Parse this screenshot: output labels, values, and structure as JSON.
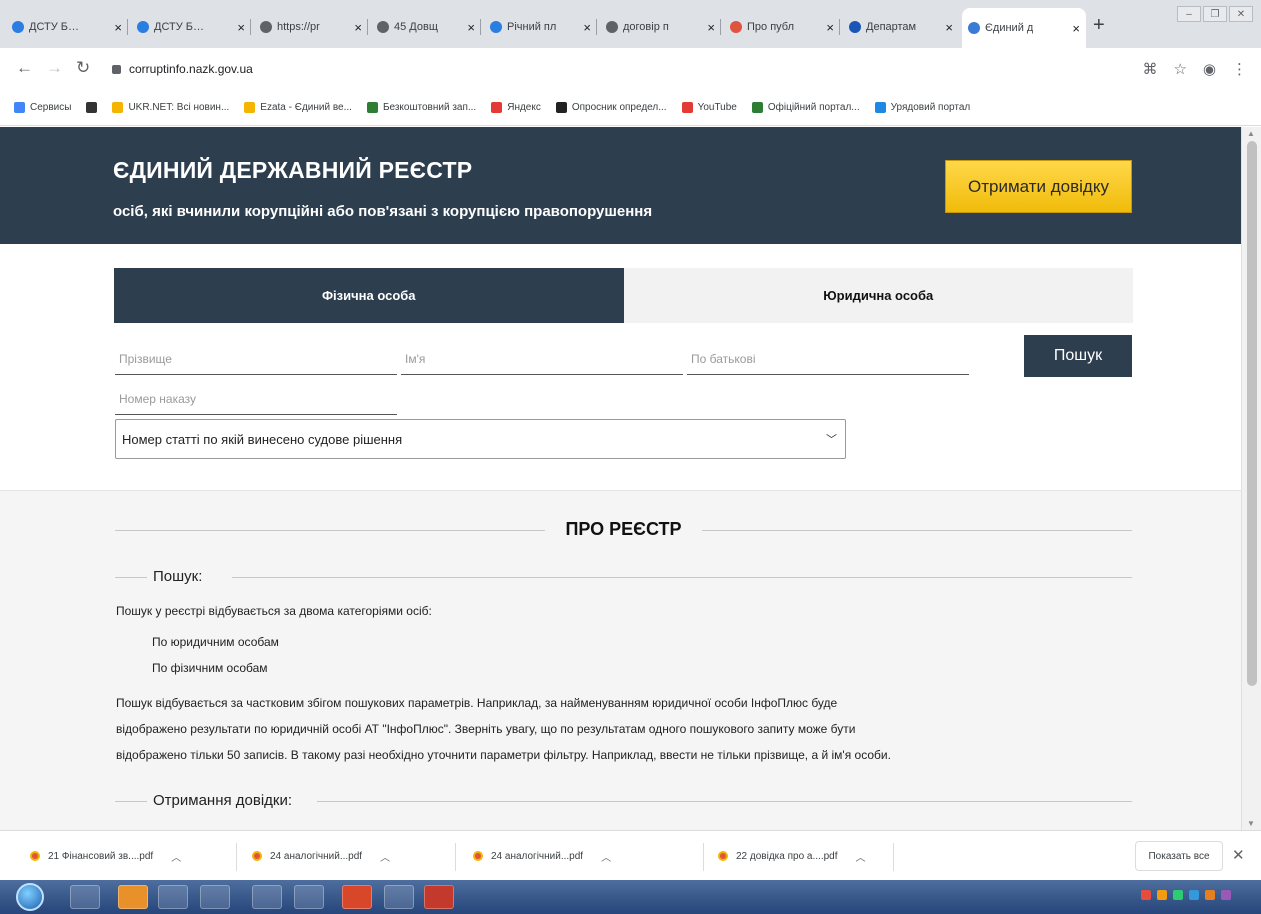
{
  "browser": {
    "tabs": [
      {
        "label": "ДСТУ Б.Д.",
        "color": "#2a7de1"
      },
      {
        "label": "ДСТУ Б.Д.",
        "color": "#2a7de1"
      },
      {
        "label": "https://pr",
        "color": "#5f6368"
      },
      {
        "label": "45 Довщ",
        "color": "#5f6368"
      },
      {
        "label": "Річний пл",
        "color": "#2a7de1"
      },
      {
        "label": "договір п",
        "color": "#5f6368"
      },
      {
        "label": "Про публ",
        "color": "#e0533f"
      },
      {
        "label": "Департам",
        "color": "#1a56b8"
      },
      {
        "label": "Єдиний д",
        "color": "#3a7bd5",
        "active": true
      }
    ],
    "url": "corruptinfo.nazk.gov.ua",
    "bookmarks": [
      {
        "label": "Сервисы",
        "color": "#4285f4"
      },
      {
        "label": "",
        "color": "#333333"
      },
      {
        "label": "UKR.NET: Всі новин...",
        "color": "#f4b400"
      },
      {
        "label": "Ezata - Єдиний ве...",
        "color": "#f4b400"
      },
      {
        "label": "Безкоштовний зап...",
        "color": "#2e7d32"
      },
      {
        "label": "Яндекс",
        "color": "#e53935"
      },
      {
        "label": "Опросник определ...",
        "color": "#222222"
      },
      {
        "label": "YouTube",
        "color": "#e53935"
      },
      {
        "label": "Офіційний портал...",
        "color": "#2e7d32"
      },
      {
        "label": "Урядовий портал",
        "color": "#1e88e5"
      }
    ]
  },
  "hero": {
    "title": "ЄДИНИЙ ДЕРЖАВНИЙ РЕЄСТР",
    "subtitle": "осіб, які вчинили корупційні або пов'язані з корупцією правопорушення",
    "cta_label": "Отримати довідку"
  },
  "person_tabs": {
    "individual": "Фізична особа",
    "legal": "Юридична особа"
  },
  "form": {
    "surname_placeholder": "Прізвище",
    "name_placeholder": "Ім'я",
    "patronymic_placeholder": "По батькові",
    "order_placeholder": "Номер наказу",
    "search_label": "Пошук",
    "article_select": "Номер статті по якій винесено судове рішення"
  },
  "about": {
    "title": "ПРО РЕЄСТР",
    "search_heading": "Пошук:",
    "search_intro": "Пошук у реєстрі відбувається за двома категоріями осіб:",
    "categories": [
      "По юридичним особам",
      "По фізичним особам"
    ],
    "details": [
      "Пошук відбувається за частковим збігом пошукових параметрів. Наприклад, за найменуванням юридичної особи ІнфоПлюс буде",
      "відображено результати по юридичній особі АТ \"ІнфоПлюс\". Зверніть увагу, що по результатам одного пошукового запиту може бути",
      "відображено тільки 50 записів. В такому разі необхідно уточнити параметри фільтру. Наприклад, ввести не тільки прізвище, а й ім'я особи."
    ],
    "certificate_heading": "Отримання довідки:"
  },
  "downloads": {
    "items": [
      "21 Фінансовий зв....pdf",
      "24 аналогічний...pdf",
      "24 аналогічний...pdf",
      "22 довідка про а....pdf"
    ],
    "show_all": "Показать все"
  },
  "colors": {
    "navy": "#2d3e4f",
    "accent_yellow": "#f5c518"
  }
}
